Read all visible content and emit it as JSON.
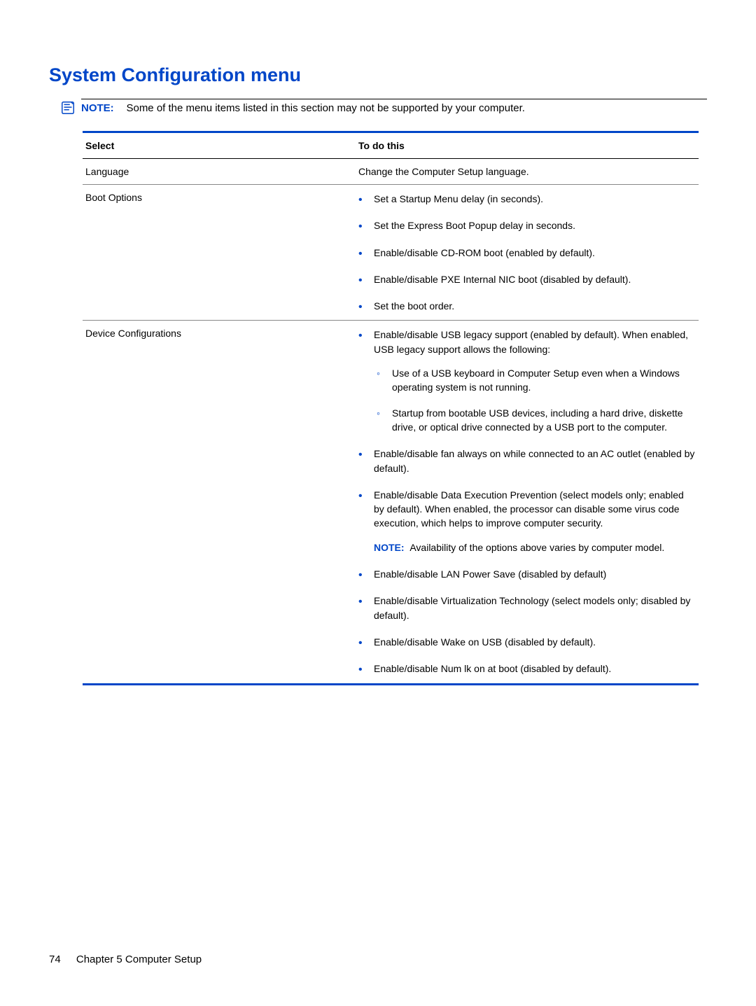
{
  "heading": "System Configuration menu",
  "top_note": {
    "label": "NOTE:",
    "text": "Some of the menu items listed in this section may not be supported by your computer."
  },
  "table": {
    "headers": {
      "select": "Select",
      "todo": "To do this"
    },
    "rows": [
      {
        "select": "Language",
        "plain": "Change the Computer Setup language."
      },
      {
        "select": "Boot Options",
        "bullets": [
          {
            "text": "Set a Startup Menu delay (in seconds)."
          },
          {
            "text": "Set the Express Boot Popup delay in seconds."
          },
          {
            "text": "Enable/disable CD-ROM boot (enabled by default)."
          },
          {
            "text": "Enable/disable PXE Internal NIC boot (disabled by default)."
          },
          {
            "text": "Set the boot order."
          }
        ]
      },
      {
        "select": "Device Configurations",
        "bullets": [
          {
            "text": "Enable/disable USB legacy support (enabled by default). When enabled, USB legacy support allows the following:",
            "sub": [
              "Use of a USB keyboard in Computer Setup even when a Windows operating system is not running.",
              "Startup from bootable USB devices, including a hard drive, diskette drive, or optical drive connected by a USB port to the computer."
            ]
          },
          {
            "text": "Enable/disable fan always on while connected to an AC outlet (enabled by default)."
          },
          {
            "text": "Enable/disable Data Execution Prevention (select models only; enabled by default). When enabled, the processor can disable some virus code execution, which helps to improve computer security.",
            "note": {
              "label": "NOTE:",
              "text": "Availability of the options above varies by computer model."
            }
          },
          {
            "text": "Enable/disable LAN Power Save (disabled by default)"
          },
          {
            "text": "Enable/disable Virtualization Technology (select models only; disabled by default)."
          },
          {
            "text": "Enable/disable Wake on USB (disabled by default)."
          },
          {
            "text": "Enable/disable Num lk on at boot (disabled by default)."
          }
        ]
      }
    ]
  },
  "footer": {
    "page": "74",
    "chapter": "Chapter 5   Computer Setup"
  }
}
